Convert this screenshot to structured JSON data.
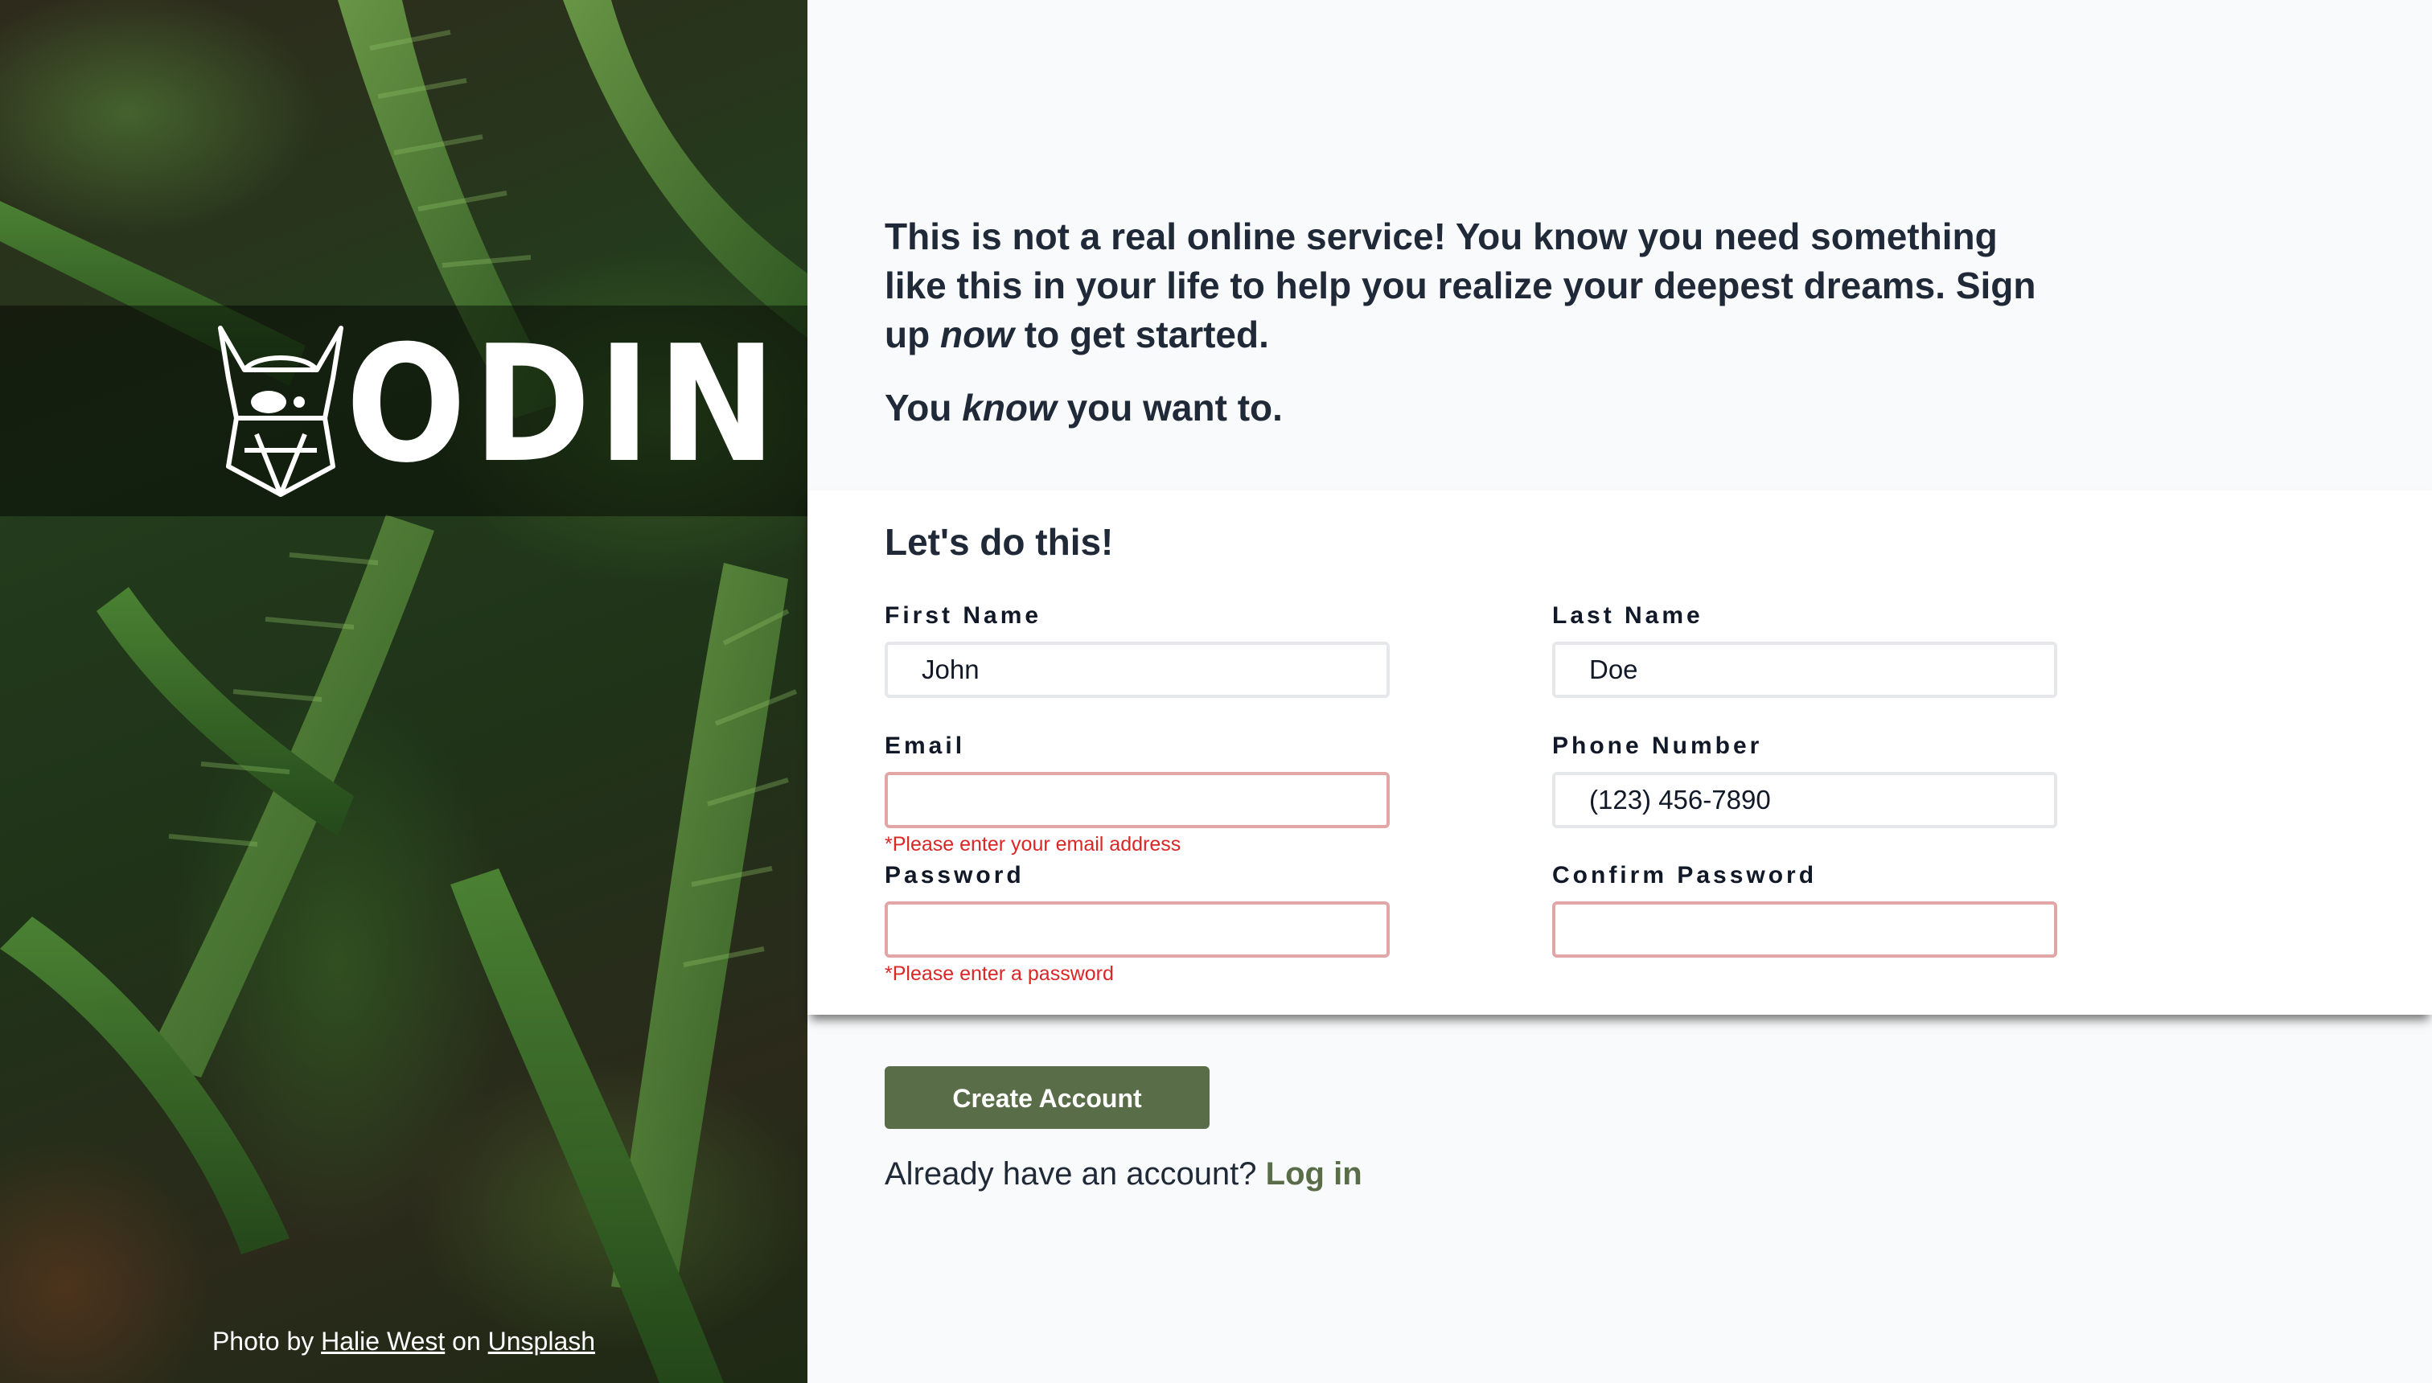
{
  "brand": {
    "logo_text": "ODIN"
  },
  "photo_credit": {
    "prefix": "Photo by",
    "author": "Halie West",
    "middle": "on",
    "source": "Unsplash"
  },
  "intro": {
    "line1_pre": "This is not a real online service! You know you need something like this in your life to help you realize your deepest dreams. Sign up",
    "line1_em": "now",
    "line1_post": "to get started.",
    "line2_pre": "You",
    "line2_em": "know",
    "line2_post": "you want to."
  },
  "form": {
    "title": "Let's do this!",
    "fields": {
      "first_name": {
        "label": "First Name",
        "value": "John"
      },
      "last_name": {
        "label": "Last Name",
        "value": "Doe"
      },
      "email": {
        "label": "Email",
        "value": "",
        "error": "*Please enter your email address"
      },
      "phone": {
        "label": "Phone Number",
        "value": "(123) 456-7890"
      },
      "password": {
        "label": "Password",
        "value": "",
        "error": "*Please enter a password"
      },
      "confirm_password": {
        "label": "Confirm Password",
        "value": ""
      }
    }
  },
  "actions": {
    "create_label": "Create Account",
    "login_prompt": "Already have an account?",
    "login_link": "Log in"
  },
  "colors": {
    "accent": "#596d48",
    "error": "#dc2626",
    "error_border": "#e2a6a6",
    "heading": "#1f2937",
    "panel_bg": "#f9fafb"
  }
}
